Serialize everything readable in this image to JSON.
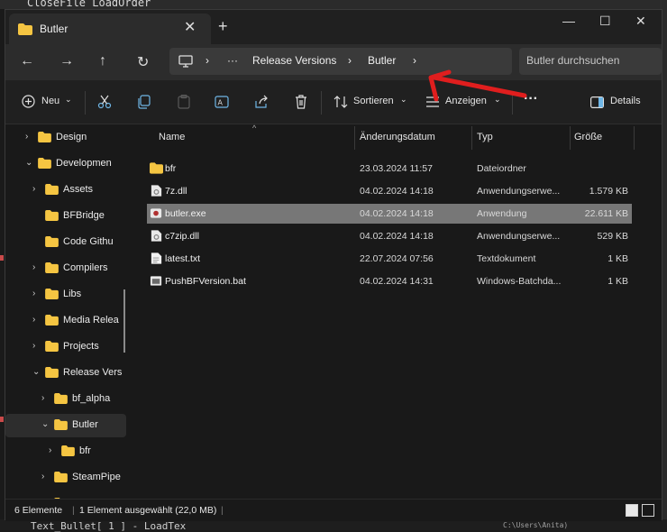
{
  "background": {
    "top_text": "CloseFile LoadOrder",
    "bottom_text": "Text_Bullet[ 1 ] - LoadTex",
    "bottom_path": "C:\\Users\\Anita)"
  },
  "window": {
    "tab_title": "Butler",
    "tab_close": "✕",
    "new_tab": "+",
    "minimize": "—",
    "maximize": "☐",
    "close": "✕"
  },
  "nav": {
    "back": "←",
    "forward": "→",
    "up": "↑",
    "refresh": "↻",
    "breadcrumb": [
      "Release Versions",
      "Butler"
    ],
    "ellipsis": "···",
    "separator": "›",
    "search_placeholder": "Butler durchsuchen"
  },
  "toolbar": {
    "new_label": "Neu",
    "sort_label": "Sortieren",
    "view_label": "Anzeigen",
    "more_label": "···",
    "details_label": "Details"
  },
  "sidebar": {
    "items": [
      {
        "label": "Design",
        "chev": "›",
        "level": 0
      },
      {
        "label": "Developmen",
        "chev": "⌄",
        "level": 0
      },
      {
        "label": "Assets",
        "chev": "›",
        "level": 1
      },
      {
        "label": "BFBridge",
        "chev": "",
        "level": 1
      },
      {
        "label": "Code Githu",
        "chev": "",
        "level": 1
      },
      {
        "label": "Compilers",
        "chev": "›",
        "level": 1
      },
      {
        "label": "Libs",
        "chev": "›",
        "level": 1
      },
      {
        "label": "Media Relea",
        "chev": "›",
        "level": 1
      },
      {
        "label": "Projects",
        "chev": "›",
        "level": 1
      },
      {
        "label": "Release Vers",
        "chev": "⌄",
        "level": 1
      },
      {
        "label": "bf_alpha",
        "chev": "›",
        "level": 2
      },
      {
        "label": "Butler",
        "chev": "⌄",
        "level": 2
      },
      {
        "label": "bfr",
        "chev": "›",
        "level": 3
      },
      {
        "label": "SteamPipe",
        "chev": "›",
        "level": 2
      },
      {
        "label": "SteamRAW",
        "chev": "›",
        "level": 2
      }
    ]
  },
  "columns": {
    "name": "Name",
    "date": "Änderungsdatum",
    "type": "Typ",
    "size": "Größe"
  },
  "files": [
    {
      "name": "bfr",
      "date": "23.03.2024 11:57",
      "type": "Dateiordner",
      "size": "",
      "icon": "folder-icon"
    },
    {
      "name": "7z.dll",
      "date": "04.02.2024 14:18",
      "type": "Anwendungserwe...",
      "size": "1.579 KB",
      "icon": "dll-file-icon"
    },
    {
      "name": "butler.exe",
      "date": "04.02.2024 14:18",
      "type": "Anwendung",
      "size": "22.611 KB",
      "icon": "exe-file-icon"
    },
    {
      "name": "c7zip.dll",
      "date": "04.02.2024 14:18",
      "type": "Anwendungserwe...",
      "size": "529 KB",
      "icon": "dll-file-icon"
    },
    {
      "name": "latest.txt",
      "date": "22.07.2024 07:56",
      "type": "Textdokument",
      "size": "1 KB",
      "icon": "text-file-icon"
    },
    {
      "name": "PushBFVersion.bat",
      "date": "04.02.2024 14:31",
      "type": "Windows-Batchda...",
      "size": "1 KB",
      "icon": "bat-file-icon"
    }
  ],
  "status": {
    "count": "6 Elemente",
    "selection": "1 Element ausgewählt (22,0 MB)"
  },
  "colors": {
    "annotation_arrow": "#e01e1e",
    "folder": "#f5c542",
    "selection": "#777777"
  }
}
